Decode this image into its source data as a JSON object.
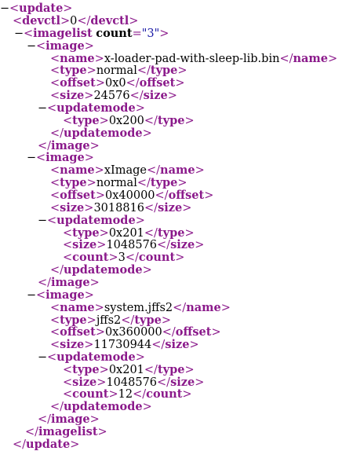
{
  "colors": {
    "tag": "#8b1a8b",
    "attribute_name": "#000000",
    "attribute_value": "#1a1aa6",
    "text": "#000000",
    "background": "#ffffff"
  },
  "xml": {
    "update_tag": "update",
    "devctl_tag": "devctl",
    "devctl_value": "0",
    "imagelist_tag": "imagelist",
    "count_attr": "count",
    "count_value": "3",
    "image_tag": "image",
    "name_tag": "name",
    "type_tag": "type",
    "offset_tag": "offset",
    "size_tag": "size",
    "updatemode_tag": "updatemode",
    "count_tag": "count",
    "images": [
      {
        "name": "x-loader-pad-with-sleep-lib.bin",
        "type": "normal",
        "offset": "0x0",
        "size": "24576",
        "updatemode": {
          "type": "0x200"
        }
      },
      {
        "name": "xImage",
        "type": "normal",
        "offset": "0x40000",
        "size": "3018816",
        "updatemode": {
          "type": "0x201",
          "size": "1048576",
          "count": "3"
        }
      },
      {
        "name": "system.jffs2",
        "type": "jffs2",
        "offset": "0x360000",
        "size": "11730944",
        "updatemode": {
          "type": "0x201",
          "size": "1048576",
          "count": "12"
        }
      }
    ]
  }
}
